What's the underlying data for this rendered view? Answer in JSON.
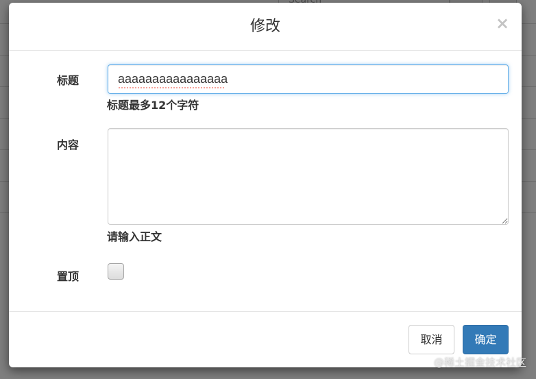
{
  "background": {
    "search_placeholder": "Search"
  },
  "modal": {
    "title": "修改",
    "close_symbol": "×",
    "fields": {
      "title": {
        "label": "标题",
        "value": "aaaaaaaaaaaaaaaa",
        "help": "标题最多12个字符"
      },
      "content": {
        "label": "内容",
        "value": "",
        "help": "请输入正文"
      },
      "pin": {
        "label": "置顶",
        "checked": false
      }
    },
    "footer": {
      "cancel_label": "取消",
      "confirm_label": "确定"
    }
  },
  "colors": {
    "primary": "#337ab7",
    "focus_border": "#66afe9",
    "overlay": "rgba(0,0,0,0.5)"
  },
  "watermark": "@稀土掘金技术社区"
}
